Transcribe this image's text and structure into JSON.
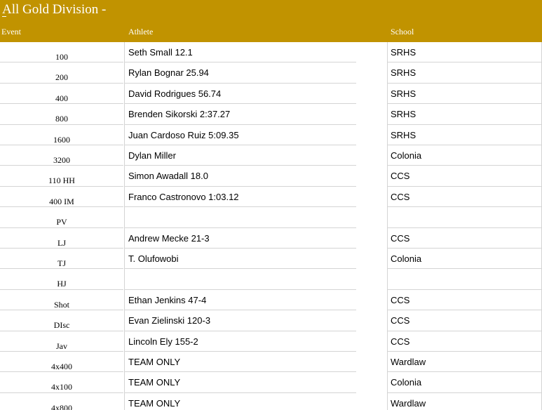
{
  "sheet": {
    "title": "All Gold Division -",
    "columns": {
      "event": "Event",
      "athlete": "Athlete",
      "school": "School"
    },
    "rows": [
      {
        "event": "100",
        "athlete": "Seth Small 12.1",
        "school": "SRHS"
      },
      {
        "event": "200",
        "athlete": "Rylan Bognar  25.94",
        "school": "SRHS"
      },
      {
        "event": "400",
        "athlete": "David Rodrigues 56.74",
        "school": "SRHS"
      },
      {
        "event": "800",
        "athlete": "Brenden Sikorski 2:37.27",
        "school": "SRHS"
      },
      {
        "event": "1600",
        "athlete": "Juan Cardoso Ruiz 5:09.35",
        "school": "SRHS"
      },
      {
        "event": "3200",
        "athlete": "Dylan Miller",
        "school": "Colonia"
      },
      {
        "event": "110 HH",
        "athlete": "Simon Awadall 18.0",
        "school": "CCS"
      },
      {
        "event": "400 IM",
        "athlete": "Franco Castronovo 1:03.12",
        "school": "CCS"
      },
      {
        "event": "PV",
        "athlete": "",
        "school": ""
      },
      {
        "event": "LJ",
        "athlete": "Andrew Mecke 21-3",
        "school": "CCS"
      },
      {
        "event": "TJ",
        "athlete": "T. Olufowobi",
        "school": "Colonia"
      },
      {
        "event": "HJ",
        "athlete": "",
        "school": ""
      },
      {
        "event": "Shot",
        "athlete": "Ethan Jenkins 47-4",
        "school": "CCS"
      },
      {
        "event": "DIsc",
        "athlete": "Evan Zielinski 120-3",
        "school": "CCS"
      },
      {
        "event": "Jav",
        "athlete": "Lincoln Ely 155-2",
        "school": "CCS"
      },
      {
        "event": "4x400",
        "athlete": "TEAM ONLY",
        "school": "Wardlaw"
      },
      {
        "event": "4x100",
        "athlete": "TEAM ONLY",
        "school": "Colonia"
      },
      {
        "event": "4x800",
        "athlete": "TEAM ONLY",
        "school": "Wardlaw"
      }
    ]
  },
  "colors": {
    "header": "#c19300",
    "grid": "#d4d4d4"
  }
}
